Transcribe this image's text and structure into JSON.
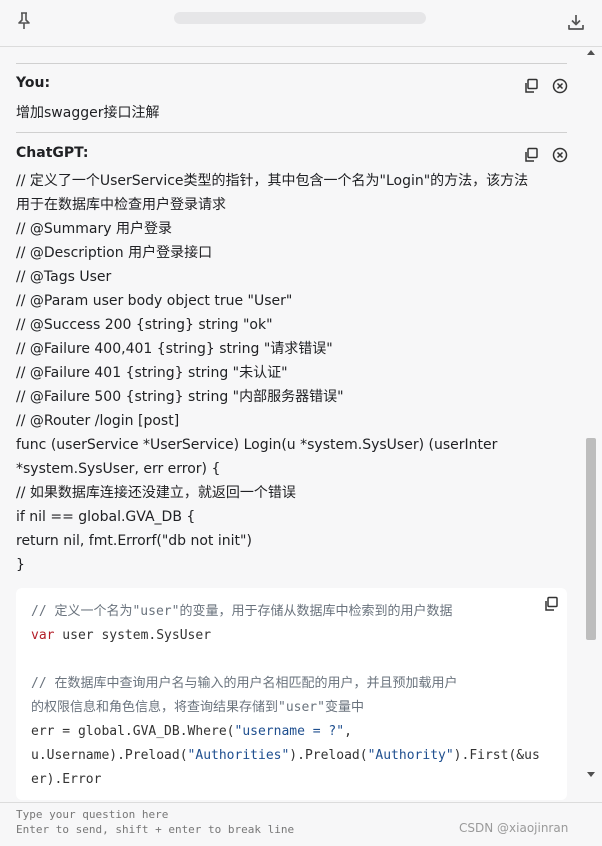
{
  "icons": {
    "pin": "pin-icon",
    "download": "download-icon",
    "copy": "copy-icon",
    "close": "close-circle-icon"
  },
  "user_message": {
    "author": "You:",
    "text": "增加swagger接口注解"
  },
  "assistant_message": {
    "author": "ChatGPT:",
    "lines": [
      "// 定义了一个UserService类型的指针，其中包含一个名为\"Login\"的方法，该方法",
      "用于在数据库中检查用户登录请求",
      "// @Summary 用户登录",
      "// @Description 用户登录接口",
      "// @Tags User",
      "// @Param user body object true \"User\"",
      "// @Success 200 {string} string \"ok\"",
      "// @Failure 400,401 {string} string \"请求错误\"",
      "// @Failure 401 {string} string \"未认证\"",
      "// @Failure 500 {string} string \"内部服务器错误\"",
      "// @Router /login [post]",
      "func (userService *UserService) Login(u *system.SysUser) (userInter",
      "*system.SysUser, err error) {",
      "// 如果数据库连接还没建立，就返回一个错误",
      "if nil == global.GVA_DB {",
      "return nil, fmt.Errorf(\"db not init\")",
      "}"
    ],
    "code": {
      "line1": "// 定义一个名为\"user\"的变量，用于存储从数据库中检索到的用户数据",
      "line2_kw": "var",
      "line2_rest": " user system.SysUser",
      "line3": "// 在数据库中查询用户名与输入的用户名相匹配的用户，并且预加载用户",
      "line4": "的权限信息和角色信息，将查询结果存储到\"user\"变量中",
      "line5_a": "err = global.GVA_DB.Where(",
      "line5_s": "\"username = ?\"",
      "line5_b": ",",
      "line6_a": "u.Username).Preload(",
      "line6_s1": "\"Authorities\"",
      "line6_b": ").Preload(",
      "line6_s2": "\"Authority\"",
      "line6_c": ").First(&us",
      "line7": "er).Error"
    }
  },
  "input": {
    "placeholder_line1": "Type your question here",
    "placeholder_line2": "Enter to send, shift + enter to break line"
  },
  "watermark": "CSDN @xiaojinran"
}
